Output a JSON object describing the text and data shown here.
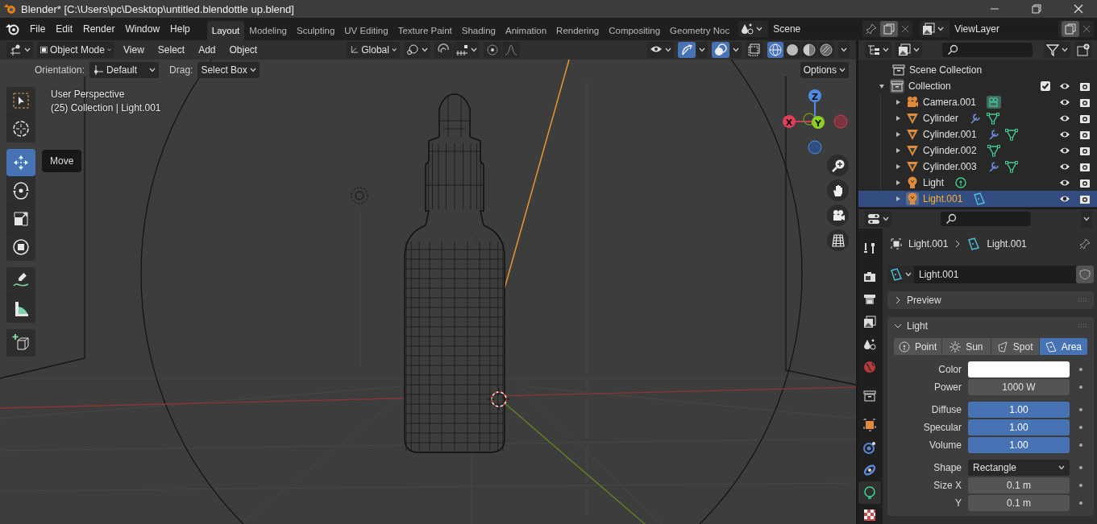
{
  "window": {
    "title": "Blender* [C:\\Users\\pc\\Desktop\\untitled.blendottle up.blend]"
  },
  "menu": [
    "File",
    "Edit",
    "Render",
    "Window",
    "Help"
  ],
  "workspaces": [
    {
      "label": "Layout",
      "selected": true
    },
    {
      "label": "Modeling",
      "selected": false
    },
    {
      "label": "Sculpting",
      "selected": false
    },
    {
      "label": "UV Editing",
      "selected": false
    },
    {
      "label": "Texture Paint",
      "selected": false
    },
    {
      "label": "Shading",
      "selected": false
    },
    {
      "label": "Animation",
      "selected": false
    },
    {
      "label": "Rendering",
      "selected": false
    },
    {
      "label": "Compositing",
      "selected": false
    },
    {
      "label": "Geometry Noc",
      "selected": false
    }
  ],
  "scene": {
    "name": "Scene"
  },
  "view_layer": {
    "name": "ViewLayer"
  },
  "viewport_header": {
    "mode": "Object Mode",
    "menus": [
      "View",
      "Select",
      "Add",
      "Object"
    ],
    "orientation": "Global",
    "gizmos": true,
    "overlays": true,
    "xray": false,
    "shading": [
      {
        "kind": "wireframe",
        "selected": true
      },
      {
        "kind": "solid",
        "selected": false
      },
      {
        "kind": "material",
        "selected": false
      },
      {
        "kind": "rendered",
        "selected": false
      }
    ]
  },
  "tool_settings": {
    "orientation_label": "Orientation:",
    "orientation": "Default",
    "drag_label": "Drag:",
    "drag": "Select Box",
    "options": "Options"
  },
  "viewport": {
    "info": [
      "User Perspective",
      "(25) Collection | Light.001"
    ],
    "tooltip": "Move",
    "tool_groups": [
      [
        {
          "kind": "select",
          "selected": false
        },
        {
          "kind": "cursor",
          "selected": false
        }
      ],
      [
        {
          "kind": "move",
          "selected": true
        },
        {
          "kind": "rotate",
          "selected": false
        },
        {
          "kind": "scale",
          "selected": false
        },
        {
          "kind": "transform",
          "selected": false
        }
      ],
      [
        {
          "kind": "annotate",
          "selected": false
        },
        {
          "kind": "measure",
          "selected": false
        }
      ],
      [
        {
          "kind": "add_cube",
          "selected": false
        }
      ]
    ],
    "axes": [
      "Z",
      "X",
      "Y"
    ]
  },
  "outliner": {
    "root": "Scene Collection",
    "collections": [
      {
        "name": "Collection",
        "expanded": true,
        "checked": true,
        "children": [
          {
            "name": "Camera.001",
            "kind": "camera",
            "data_icon": {
              "kind": "camera"
            },
            "modifier": false,
            "expanded": false,
            "selected": false
          },
          {
            "name": "Cylinder",
            "kind": "mesh",
            "data_icon": {
              "kind": "mesh"
            },
            "modifier": true,
            "expanded": false,
            "selected": false
          },
          {
            "name": "Cylinder.001",
            "kind": "mesh",
            "data_icon": {
              "kind": "mesh"
            },
            "modifier": true,
            "expanded": false,
            "selected": false
          },
          {
            "name": "Cylinder.002",
            "kind": "mesh",
            "data_icon": {
              "kind": "mesh"
            },
            "modifier": false,
            "expanded": false,
            "selected": false
          },
          {
            "name": "Cylinder.003",
            "kind": "mesh",
            "data_icon": {
              "kind": "mesh"
            },
            "modifier": true,
            "expanded": false,
            "selected": false
          },
          {
            "name": "Light",
            "kind": "light",
            "data_icon": {
              "kind": "point_light"
            },
            "modifier": false,
            "expanded": false,
            "selected": false
          },
          {
            "name": "Light.001",
            "kind": "light",
            "data_icon": {
              "kind": "area_light"
            },
            "modifier": false,
            "expanded": false,
            "selected": true
          }
        ]
      }
    ]
  },
  "properties": {
    "tab_groups": [
      [
        {
          "kind": "tool",
          "selected": false
        }
      ],
      [
        {
          "kind": "render",
          "selected": false
        },
        {
          "kind": "output",
          "selected": false
        },
        {
          "kind": "view_layer",
          "selected": false
        },
        {
          "kind": "scene",
          "selected": false
        },
        {
          "kind": "world",
          "selected": false
        }
      ],
      [
        {
          "kind": "collection",
          "selected": false
        }
      ],
      [
        {
          "kind": "object",
          "selected": false
        },
        {
          "kind": "physics",
          "selected": false
        },
        {
          "kind": "constraints",
          "selected": false
        },
        {
          "kind": "data",
          "selected": true
        },
        {
          "kind": "texture",
          "selected": false
        }
      ]
    ],
    "breadcrumb": [
      "Light.001",
      "Light.001"
    ],
    "datablock": "Light.001",
    "panels": [
      {
        "title": "Preview",
        "expanded": false
      },
      {
        "title": "Light",
        "expanded": true
      }
    ],
    "light_types": [
      {
        "label": "Point",
        "kind": "point",
        "selected": false
      },
      {
        "label": "Sun",
        "kind": "sun",
        "selected": false
      },
      {
        "label": "Spot",
        "kind": "spot",
        "selected": false
      },
      {
        "label": "Area",
        "kind": "area",
        "selected": true
      }
    ],
    "property_groups": [
      [
        {
          "label": "Color",
          "kind": "color",
          "color": "#ffffff"
        },
        {
          "label": "Power",
          "kind": "number",
          "value": "1000 W"
        }
      ],
      [
        {
          "label": "Diffuse",
          "kind": "slider",
          "value": "1.00",
          "level": 1
        },
        {
          "label": "Specular",
          "kind": "slider",
          "value": "1.00",
          "level": 1
        },
        {
          "label": "Volume",
          "kind": "slider",
          "value": "1.00",
          "level": 1
        }
      ],
      [
        {
          "label": "Shape",
          "kind": "dropdown",
          "value": "Rectangle"
        },
        {
          "label": "Size X",
          "kind": "number",
          "value": "0.1 m"
        },
        {
          "label": "Y",
          "kind": "number",
          "value": "0.1 m"
        }
      ]
    ]
  }
}
